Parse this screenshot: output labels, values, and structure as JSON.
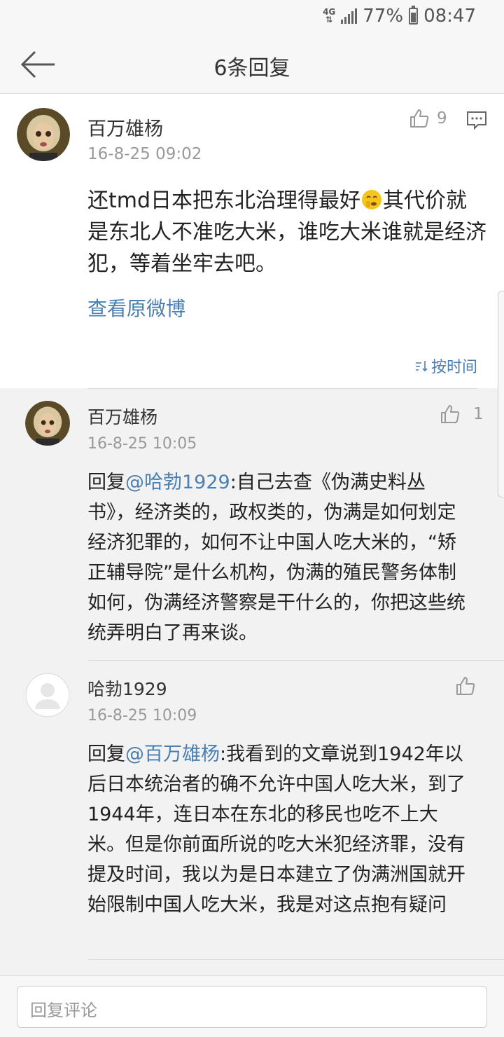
{
  "statusbar": {
    "network": "4G",
    "battery": "77%",
    "time": "08:47"
  },
  "header": {
    "title": "6条回复"
  },
  "post": {
    "username": "百万雄杨",
    "time": "16-8-25 09:02",
    "likes": "9",
    "text_before_emoji": "还tmd日本把东北治理得最好",
    "text_after_emoji": "其代价就是东北人不准吃大米，谁吃大米谁就是经济犯，等着坐牢去吧。",
    "view_original": "查看原微博",
    "sort_label": "按时间"
  },
  "replies": [
    {
      "username": "百万雄杨",
      "time": "16-8-25 10:05",
      "likes": "1",
      "prefix": "回复",
      "mention": "@哈勃1929",
      "text": ":自己去查《伪满史料丛书》，经济类的，政权类的，伪满是如何划定经济犯罪的，如何不让中国人吃大米的，“矫正辅导院”是什么机构，伪满的殖民警务体制如何，伪满经济警察是干什么的，你把这些统统弄明白了再来谈。"
    },
    {
      "username": "哈勃1929",
      "time": "16-8-25 10:09",
      "likes": "",
      "prefix": "回复",
      "mention": "@百万雄杨",
      "text": ":我看到的文章说到1942年以后日本统治者的确不允许中国人吃大米，到了1944年，连日本在东北的移民也吃不上大米。但是你前面所说的吃大米犯经济罪，没有提及时间，我以为是日本建立了伪满洲国就开始限制中国人吃大米，我是对这点抱有疑问"
    }
  ],
  "composer": {
    "placeholder": "回复评论"
  }
}
